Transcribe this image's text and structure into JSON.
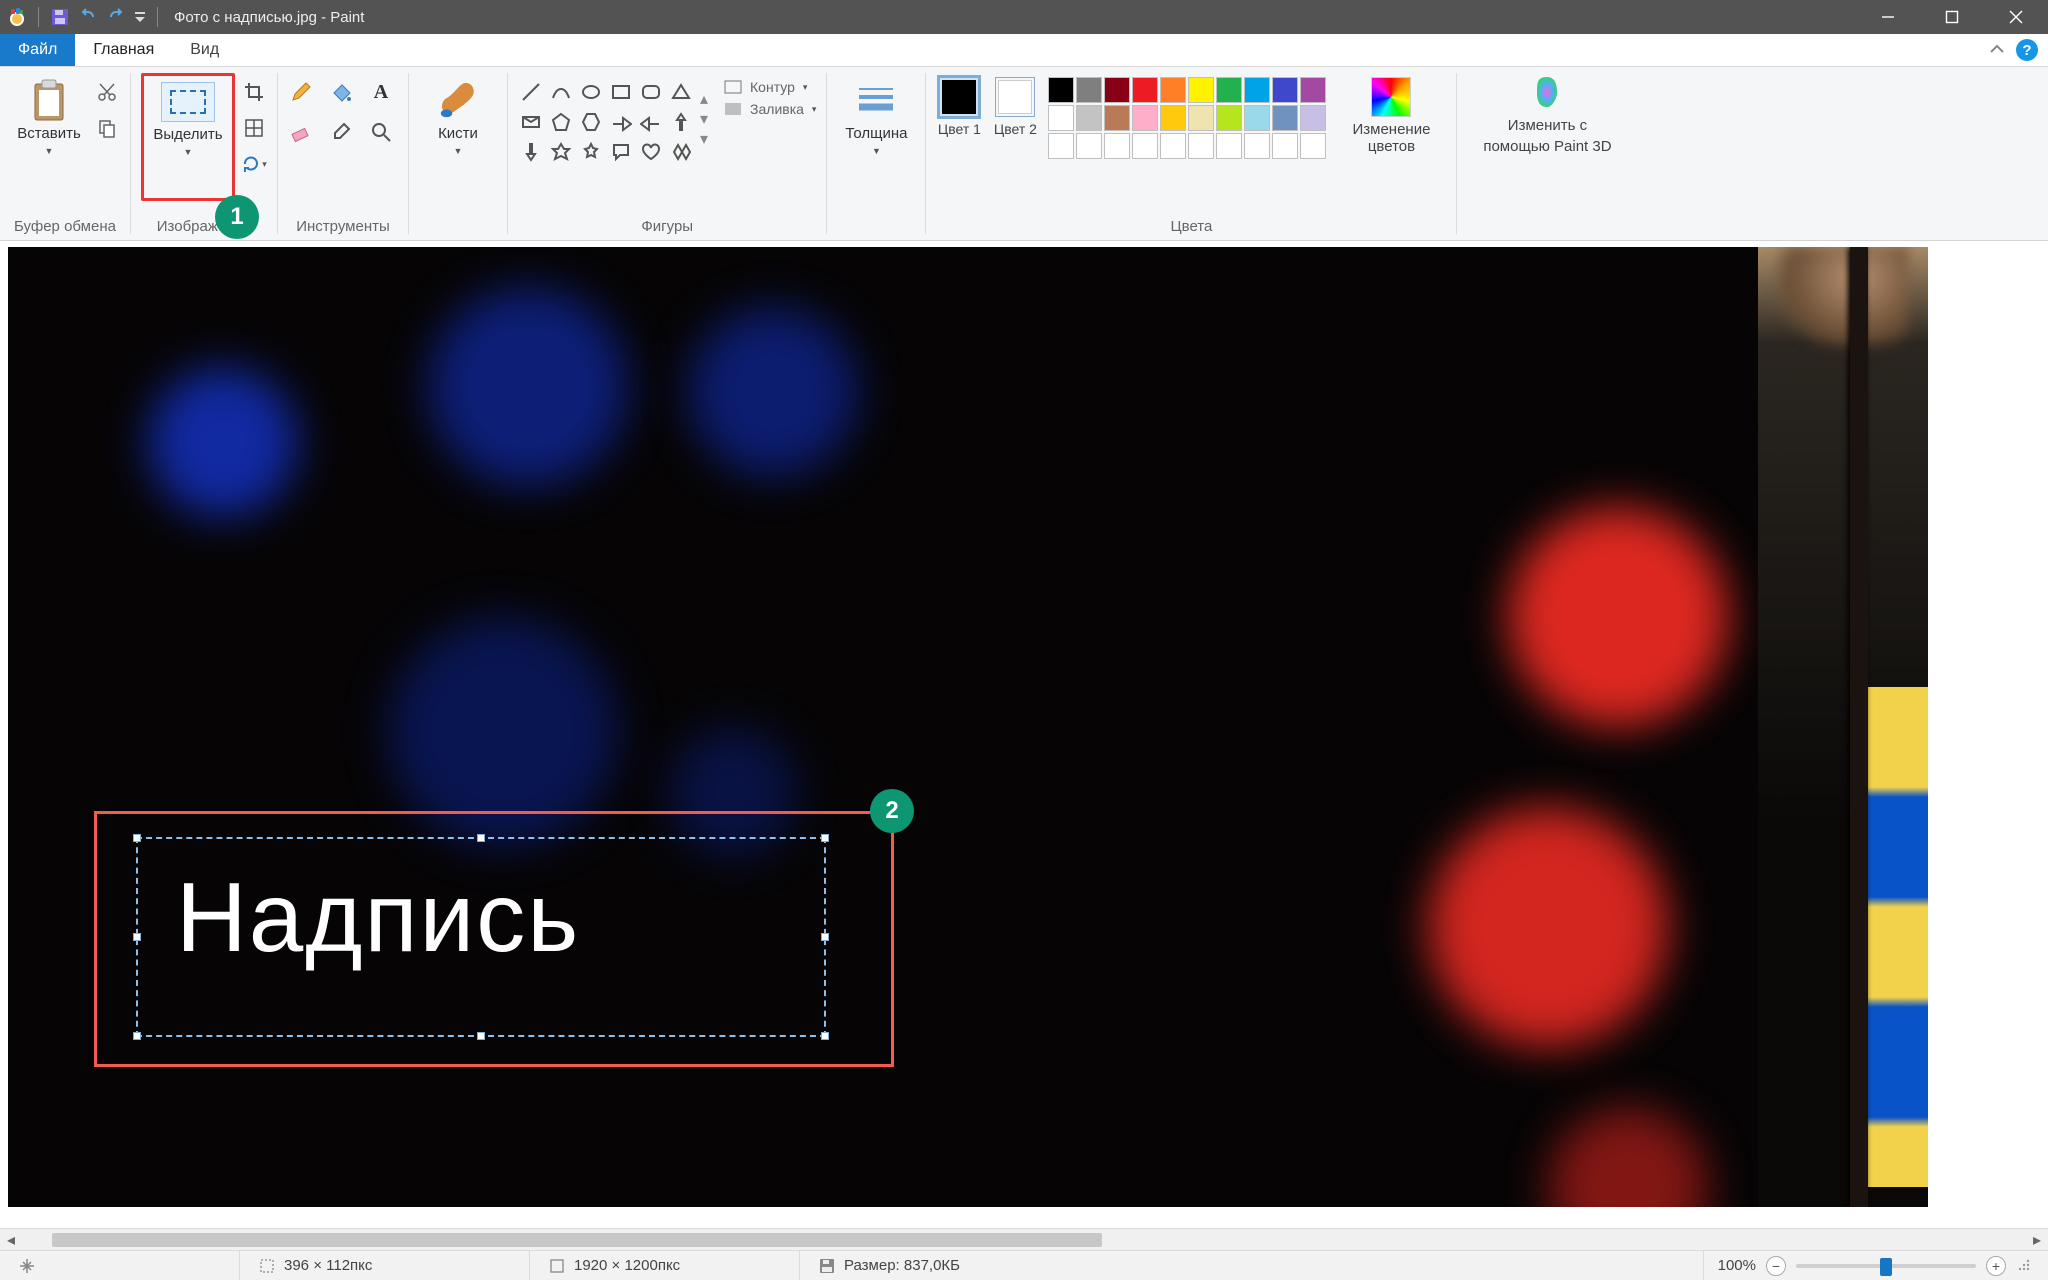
{
  "titlebar": {
    "filename": "Фото с надписью.jpg - Paint"
  },
  "tabs": {
    "file": "Файл",
    "home": "Главная",
    "view": "Вид"
  },
  "groups": {
    "clipboard": {
      "label": "Буфер обмена",
      "paste": "Вставить"
    },
    "image": {
      "label": "Изображение",
      "select": "Выделить"
    },
    "tools": {
      "label": "Инструменты"
    },
    "brushes": {
      "label": "Кисти"
    },
    "shapes": {
      "label": "Фигуры",
      "outline": "Контур",
      "fill": "Заливка"
    },
    "thickness": {
      "label": "Толщина"
    },
    "colors": {
      "label": "Цвета",
      "c1": "Цвет 1",
      "c2": "Цвет 2",
      "edit": "Изменение цветов"
    },
    "paint3d": {
      "line1": "Изменить с",
      "line2": "помощью Paint 3D"
    }
  },
  "palette": {
    "row1": [
      "#000000",
      "#7f7f7f",
      "#880015",
      "#ed1c24",
      "#ff7f27",
      "#fff200",
      "#22b14c",
      "#00a2e8",
      "#3f48cc",
      "#a349a4"
    ],
    "row2": [
      "#ffffff",
      "#c3c3c3",
      "#b97a57",
      "#ffaec9",
      "#ffc90e",
      "#efe4b0",
      "#b5e61d",
      "#99d9ea",
      "#7092be",
      "#c8bfe7"
    ]
  },
  "canvas": {
    "caption": "Надпись"
  },
  "annotations": {
    "b1": "1",
    "b2": "2"
  },
  "status": {
    "sel": "396 × 112пкс",
    "size": "1920 × 1200пкс",
    "disk_label": "Размер: ",
    "disk": "837,0КБ",
    "zoom": "100%"
  }
}
